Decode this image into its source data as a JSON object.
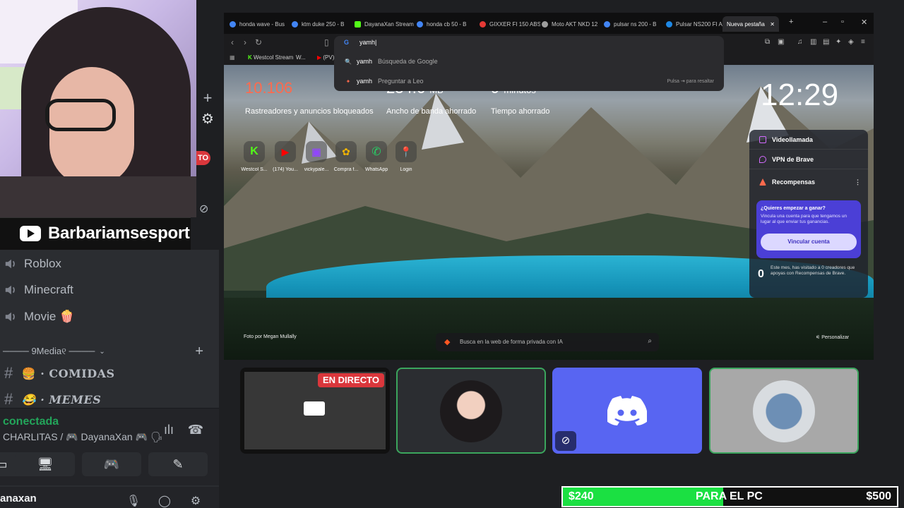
{
  "stream": {
    "channel_name": "Barbariamsesport",
    "goal": {
      "current": "$240",
      "label": "PARA EL PC",
      "target": "$500",
      "progress": 0.48,
      "fill_color": "#1be042"
    }
  },
  "discord": {
    "voice_channels": [
      {
        "label": "Roblox",
        "icon": "speaker-icon"
      },
      {
        "label": "Minecraft",
        "icon": "speaker-icon"
      },
      {
        "label": "Movie 🍿",
        "icon": "speaker-icon"
      }
    ],
    "category": "──── 9Media୧ ────",
    "text_channels": [
      {
        "label": "🍔 · COMIDAS"
      },
      {
        "label": "😂 · MEMES"
      }
    ],
    "voice_panel": {
      "status": "conectada",
      "channel": "CHARLITAS / 🎮 DayanaXan 🎮 🗣"
    },
    "user": {
      "name": "anaxan"
    },
    "live_badge": "EN DIRECTO",
    "server_live": "TO",
    "accent": "#5865f2",
    "speaking_border": "#3ba55d"
  },
  "browser": {
    "tabs": [
      {
        "label": "honda wave - Bus",
        "color": "#4285f4"
      },
      {
        "label": "ktm duke 250 - B",
        "color": "#4285f4"
      },
      {
        "label": "DayanaXan Stream",
        "color": "#53fc18"
      },
      {
        "label": "honda cb 50 - B",
        "color": "#4285f4"
      },
      {
        "label": "GIXXER FI 150 ABS",
        "color": "#e53935"
      },
      {
        "label": "Moto AKT NKD 12",
        "color": "#9e9e9e"
      },
      {
        "label": "pulsar ns 200 - B",
        "color": "#4285f4"
      },
      {
        "label": "Pulsar NS200 FI AB",
        "color": "#1e88e5"
      },
      {
        "label": "Nueva pestaña",
        "color": "#ff5722"
      }
    ],
    "address_text": "yamh|",
    "bookmarks": [
      "Westcol Stream",
      "W...",
      "(PV) Y"
    ],
    "suggestions": [
      {
        "query": "yamh",
        "desc": "Búsqueda de Google",
        "hint": ""
      },
      {
        "query": "yamh",
        "desc": "Preguntar a Leo",
        "hint": "Pulsa ⇥ para resaltar"
      }
    ],
    "stats": [
      {
        "value": "10.106",
        "label": "Rastreadores y anuncios bloqueados",
        "color": "#ff6a4d",
        "unit": ""
      },
      {
        "value": "234.6",
        "label": "Ancho de banda ahorrado",
        "color": "#ffffff",
        "unit": "MB"
      },
      {
        "value": "9",
        "label": "Tiempo ahorrado",
        "color": "#ffffff",
        "unit": "minutos"
      }
    ],
    "clock": "12:29",
    "top_sites": [
      {
        "label": "Westcol S...",
        "icon": "kick-icon",
        "color": "#53fc18"
      },
      {
        "label": "(174) You...",
        "icon": "youtube-icon",
        "color": "#ff0000"
      },
      {
        "label": "vickypale...",
        "icon": "twitch-icon",
        "color": "#9146ff"
      },
      {
        "label": "Compra f...",
        "icon": "colorwheel-icon",
        "color": "#f4b400"
      },
      {
        "label": "WhatsApp",
        "icon": "whatsapp-icon",
        "color": "#25d366"
      },
      {
        "label": "Login",
        "icon": "pin-icon",
        "color": "#e53935"
      }
    ],
    "rewards": {
      "rows": [
        "Videollamada",
        "VPN de Brave",
        "Recompensas"
      ],
      "card_title": "¿Quieres empezar a ganar?",
      "card_desc": "Vincula una cuenta para que tengamos un lugar al que enviar tus ganancias.",
      "card_button": "Vincular cuenta",
      "zero": "0",
      "zero_desc": "Este mes, has visitado a 0 creadores que apoyas con Recompensas de Brave."
    },
    "photo_credit": "Foto por Megan Mullally",
    "customize": "Personalizar",
    "ai_placeholder": "Busca en la web de forma privada con IA"
  }
}
